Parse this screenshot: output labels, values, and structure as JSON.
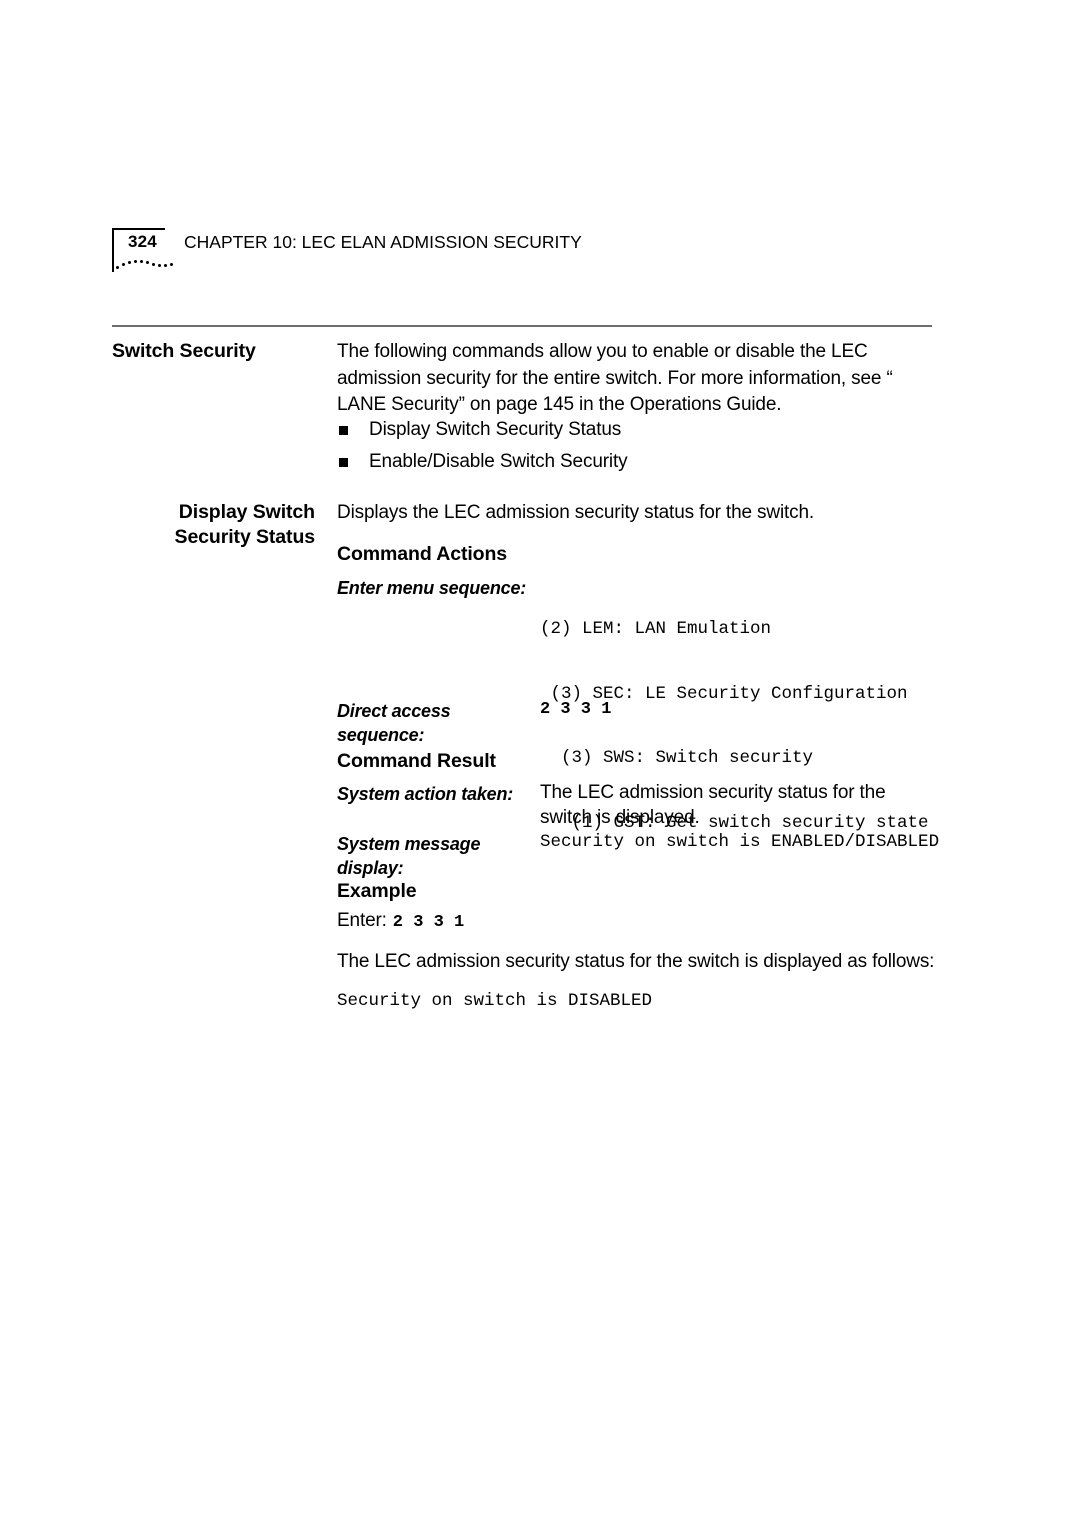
{
  "header": {
    "page_number": "324",
    "chapter_title": "CHAPTER 10: LEC ELAN ADMISSION SECURITY"
  },
  "sections": {
    "switch_security": {
      "margin_heading": "Switch Security",
      "intro_paragraph": "The following commands allow you to enable or disable the LEC admission security for the entire switch. For more information, see “ LANE Security”  on page 145 in the Operations Guide.",
      "bullets": [
        "Display Switch Security Status",
        "Enable/Disable Switch Security"
      ]
    },
    "display_switch_security_status": {
      "margin_heading_line1": "Display Switch",
      "margin_heading_line2": "Security Status",
      "description": "Displays the LEC admission security status for the switch.",
      "command_actions": {
        "heading": "Command Actions",
        "enter_menu_sequence_label": "Enter menu sequence:",
        "enter_menu_sequence_lines": [
          "(2) LEM: LAN Emulation",
          " (3) SEC: LE Security Configuration",
          "  (3) SWS: Switch security",
          "   (1) GST: Get switch security state"
        ],
        "direct_access_sequence_label": "Direct access sequence:",
        "direct_access_sequence_value": "2 3 3 1"
      },
      "command_result": {
        "heading": "Command Result",
        "system_action_taken_label": "System action taken:",
        "system_action_taken_value": "The LEC admission security status for the switch is displayed.",
        "system_message_display_label": "System message display:",
        "system_message_display_value": "Security on switch is ENABLED/DISABLED"
      },
      "example": {
        "heading": "Example",
        "enter_prefix": "Enter:",
        "enter_value": "2 3 3 1",
        "result_text": "The LEC admission security status for the switch is displayed as follows:",
        "result_output": "Security on switch is DISABLED"
      }
    }
  }
}
